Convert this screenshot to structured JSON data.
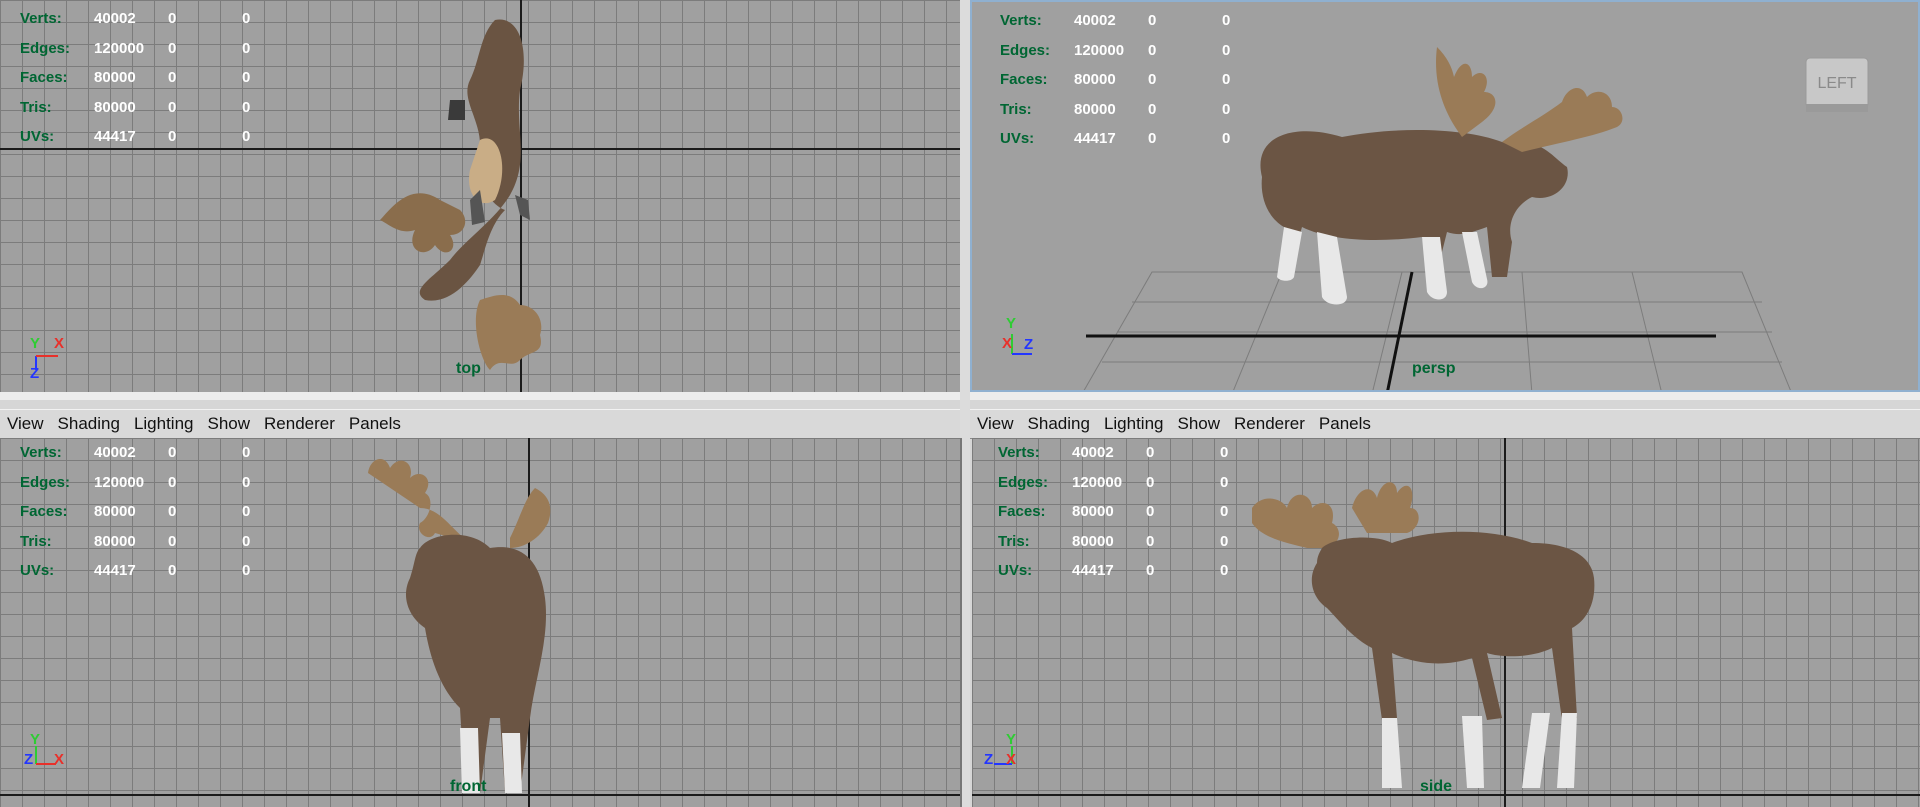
{
  "menu": [
    "View",
    "Shading",
    "Lighting",
    "Show",
    "Renderer",
    "Panels"
  ],
  "hud_labels": [
    "Verts:",
    "Edges:",
    "Faces:",
    "Tris:",
    "UVs:"
  ],
  "hud_values": [
    [
      "40002",
      "0",
      "0"
    ],
    [
      "120000",
      "0",
      "0"
    ],
    [
      "80000",
      "0",
      "0"
    ],
    [
      "80000",
      "0",
      "0"
    ],
    [
      "44417",
      "0",
      "0"
    ]
  ],
  "cameras": {
    "top": "top",
    "persp": "persp",
    "front": "front",
    "side": "side"
  },
  "view_cube_label": "LEFT",
  "axes": {
    "x": "X",
    "y": "Y",
    "z": "Z"
  },
  "colors": {
    "viewport_bg": "#a0a0a0",
    "hud_label": "#006633",
    "hud_value": "#ffffff",
    "menu_bg": "#d9d9d9",
    "active_border": "#8fb0d0",
    "axis_x": "#e8302a",
    "axis_y": "#2ecc33",
    "axis_z": "#2336ff"
  },
  "icons": {
    "view_cube": "view-cube-icon",
    "axis_gizmo": "axis-gizmo-icon"
  }
}
